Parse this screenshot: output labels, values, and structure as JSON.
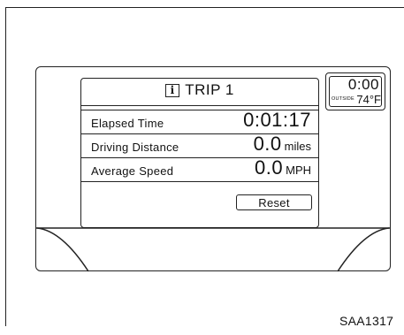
{
  "screen": {
    "title": "TRIP 1",
    "title_icon": "info-icon",
    "info_glyph": "i",
    "rows": [
      {
        "label": "Elapsed Time",
        "value": "0:01:17",
        "unit": ""
      },
      {
        "label": "Driving Distance",
        "value": "0.0",
        "unit": "miles"
      },
      {
        "label": "Average Speed",
        "value": "0.0",
        "unit": "MPH"
      }
    ],
    "reset_label": "Reset"
  },
  "clock": {
    "time": "0:00",
    "outside_label": "OUTSIDE",
    "temperature": "74°F"
  },
  "figure_code": "SAA1317"
}
